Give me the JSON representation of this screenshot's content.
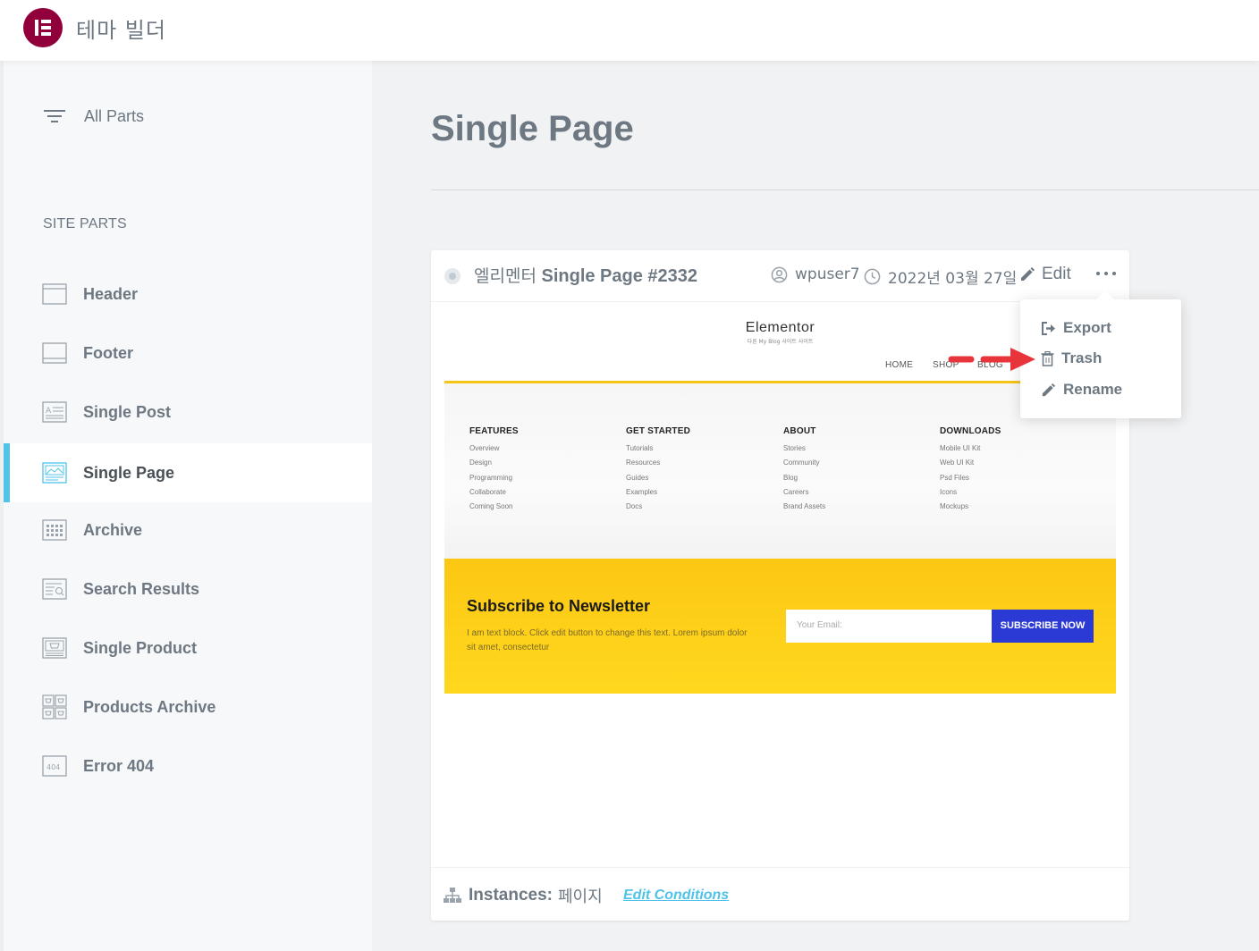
{
  "app": {
    "title": "테마 빌더"
  },
  "sidebar": {
    "all_parts": "All Parts",
    "section_title": "SITE PARTS",
    "items": [
      {
        "label": "Header",
        "icon": "header-icon"
      },
      {
        "label": "Footer",
        "icon": "footer-icon"
      },
      {
        "label": "Single Post",
        "icon": "single-post-icon"
      },
      {
        "label": "Single Page",
        "icon": "single-page-icon",
        "active": true
      },
      {
        "label": "Archive",
        "icon": "archive-icon"
      },
      {
        "label": "Search Results",
        "icon": "search-results-icon"
      },
      {
        "label": "Single Product",
        "icon": "single-product-icon"
      },
      {
        "label": "Products Archive",
        "icon": "products-archive-icon"
      },
      {
        "label": "Error 404",
        "icon": "error-404-icon"
      }
    ]
  },
  "main": {
    "title": "Single Page"
  },
  "card": {
    "title_prefix": "엘리멘터",
    "title_name": "Single Page #2332",
    "author": "wpuser7",
    "date": "2022년 03월 27일",
    "edit_label": "Edit",
    "instances_label": "Instances:",
    "instances_value": "페이지",
    "edit_conditions": "Edit Conditions"
  },
  "preview": {
    "site_title": "Elementor",
    "tagline": "다른 My Blog 사이트 사이트",
    "nav": [
      "HOME",
      "SHOP",
      "BLOG"
    ],
    "columns": [
      {
        "title": "FEATURES",
        "links": [
          "Overview",
          "Design",
          "Programming",
          "Collaborate",
          "Coming Soon"
        ]
      },
      {
        "title": "GET STARTED",
        "links": [
          "Tutorials",
          "Resources",
          "Guides",
          "Examples",
          "Docs"
        ]
      },
      {
        "title": "ABOUT",
        "links": [
          "Stories",
          "Community",
          "Blog",
          "Careers",
          "Brand Assets"
        ]
      },
      {
        "title": "DOWNLOADS",
        "links": [
          "Mobile UI Kit",
          "Web UI Kit",
          "Psd Files",
          "Icons",
          "Mockups"
        ]
      }
    ],
    "newsletter": {
      "title": "Subscribe to Newsletter",
      "text": "I am text block. Click edit button to change this text. Lorem ipsum dolor sit amet, consectetur",
      "email_placeholder": "Your Email:",
      "button": "SUBSCRIBE NOW"
    }
  },
  "dropdown": {
    "export": "Export",
    "trash": "Trash",
    "rename": "Rename"
  },
  "colors": {
    "brand": "#92003b",
    "accent": "#4fc3e8",
    "newsletter_bg": "#fcc713",
    "subscribe_btn": "#2b3ad4",
    "arrow": "#e8343b"
  }
}
